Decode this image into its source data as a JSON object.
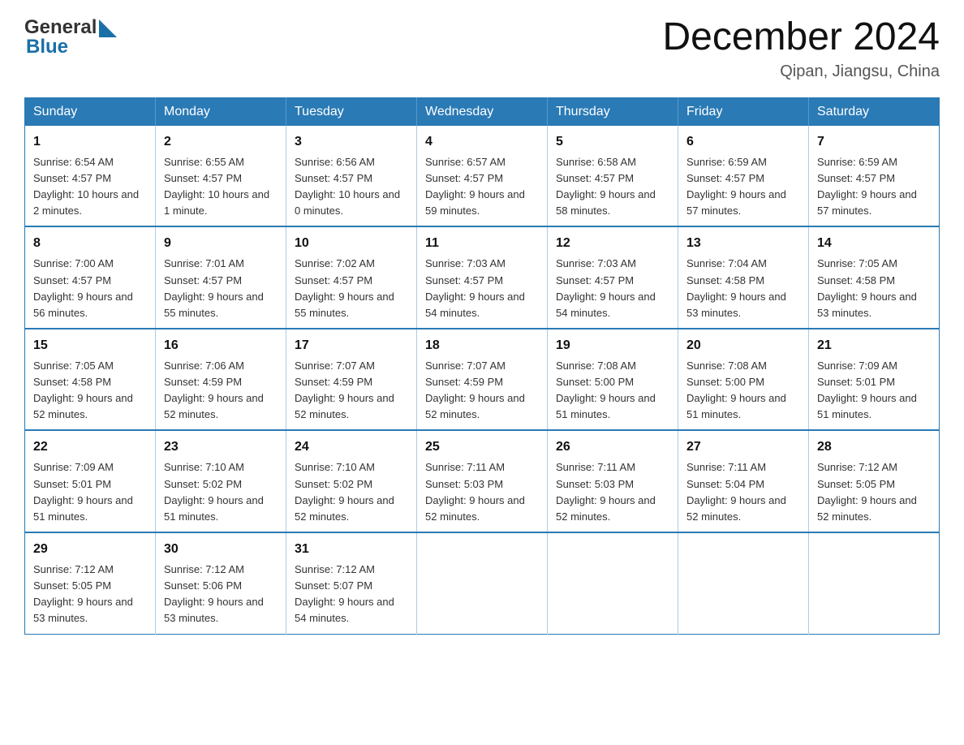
{
  "logo": {
    "text_general": "General",
    "text_blue": "Blue"
  },
  "header": {
    "month_title": "December 2024",
    "location": "Qipan, Jiangsu, China"
  },
  "days_of_week": [
    "Sunday",
    "Monday",
    "Tuesday",
    "Wednesday",
    "Thursday",
    "Friday",
    "Saturday"
  ],
  "weeks": [
    [
      {
        "day": "1",
        "sunrise": "6:54 AM",
        "sunset": "4:57 PM",
        "daylight": "10 hours and 2 minutes."
      },
      {
        "day": "2",
        "sunrise": "6:55 AM",
        "sunset": "4:57 PM",
        "daylight": "10 hours and 1 minute."
      },
      {
        "day": "3",
        "sunrise": "6:56 AM",
        "sunset": "4:57 PM",
        "daylight": "10 hours and 0 minutes."
      },
      {
        "day": "4",
        "sunrise": "6:57 AM",
        "sunset": "4:57 PM",
        "daylight": "9 hours and 59 minutes."
      },
      {
        "day": "5",
        "sunrise": "6:58 AM",
        "sunset": "4:57 PM",
        "daylight": "9 hours and 58 minutes."
      },
      {
        "day": "6",
        "sunrise": "6:59 AM",
        "sunset": "4:57 PM",
        "daylight": "9 hours and 57 minutes."
      },
      {
        "day": "7",
        "sunrise": "6:59 AM",
        "sunset": "4:57 PM",
        "daylight": "9 hours and 57 minutes."
      }
    ],
    [
      {
        "day": "8",
        "sunrise": "7:00 AM",
        "sunset": "4:57 PM",
        "daylight": "9 hours and 56 minutes."
      },
      {
        "day": "9",
        "sunrise": "7:01 AM",
        "sunset": "4:57 PM",
        "daylight": "9 hours and 55 minutes."
      },
      {
        "day": "10",
        "sunrise": "7:02 AM",
        "sunset": "4:57 PM",
        "daylight": "9 hours and 55 minutes."
      },
      {
        "day": "11",
        "sunrise": "7:03 AM",
        "sunset": "4:57 PM",
        "daylight": "9 hours and 54 minutes."
      },
      {
        "day": "12",
        "sunrise": "7:03 AM",
        "sunset": "4:57 PM",
        "daylight": "9 hours and 54 minutes."
      },
      {
        "day": "13",
        "sunrise": "7:04 AM",
        "sunset": "4:58 PM",
        "daylight": "9 hours and 53 minutes."
      },
      {
        "day": "14",
        "sunrise": "7:05 AM",
        "sunset": "4:58 PM",
        "daylight": "9 hours and 53 minutes."
      }
    ],
    [
      {
        "day": "15",
        "sunrise": "7:05 AM",
        "sunset": "4:58 PM",
        "daylight": "9 hours and 52 minutes."
      },
      {
        "day": "16",
        "sunrise": "7:06 AM",
        "sunset": "4:59 PM",
        "daylight": "9 hours and 52 minutes."
      },
      {
        "day": "17",
        "sunrise": "7:07 AM",
        "sunset": "4:59 PM",
        "daylight": "9 hours and 52 minutes."
      },
      {
        "day": "18",
        "sunrise": "7:07 AM",
        "sunset": "4:59 PM",
        "daylight": "9 hours and 52 minutes."
      },
      {
        "day": "19",
        "sunrise": "7:08 AM",
        "sunset": "5:00 PM",
        "daylight": "9 hours and 51 minutes."
      },
      {
        "day": "20",
        "sunrise": "7:08 AM",
        "sunset": "5:00 PM",
        "daylight": "9 hours and 51 minutes."
      },
      {
        "day": "21",
        "sunrise": "7:09 AM",
        "sunset": "5:01 PM",
        "daylight": "9 hours and 51 minutes."
      }
    ],
    [
      {
        "day": "22",
        "sunrise": "7:09 AM",
        "sunset": "5:01 PM",
        "daylight": "9 hours and 51 minutes."
      },
      {
        "day": "23",
        "sunrise": "7:10 AM",
        "sunset": "5:02 PM",
        "daylight": "9 hours and 51 minutes."
      },
      {
        "day": "24",
        "sunrise": "7:10 AM",
        "sunset": "5:02 PM",
        "daylight": "9 hours and 52 minutes."
      },
      {
        "day": "25",
        "sunrise": "7:11 AM",
        "sunset": "5:03 PM",
        "daylight": "9 hours and 52 minutes."
      },
      {
        "day": "26",
        "sunrise": "7:11 AM",
        "sunset": "5:03 PM",
        "daylight": "9 hours and 52 minutes."
      },
      {
        "day": "27",
        "sunrise": "7:11 AM",
        "sunset": "5:04 PM",
        "daylight": "9 hours and 52 minutes."
      },
      {
        "day": "28",
        "sunrise": "7:12 AM",
        "sunset": "5:05 PM",
        "daylight": "9 hours and 52 minutes."
      }
    ],
    [
      {
        "day": "29",
        "sunrise": "7:12 AM",
        "sunset": "5:05 PM",
        "daylight": "9 hours and 53 minutes."
      },
      {
        "day": "30",
        "sunrise": "7:12 AM",
        "sunset": "5:06 PM",
        "daylight": "9 hours and 53 minutes."
      },
      {
        "day": "31",
        "sunrise": "7:12 AM",
        "sunset": "5:07 PM",
        "daylight": "9 hours and 54 minutes."
      },
      null,
      null,
      null,
      null
    ]
  ]
}
